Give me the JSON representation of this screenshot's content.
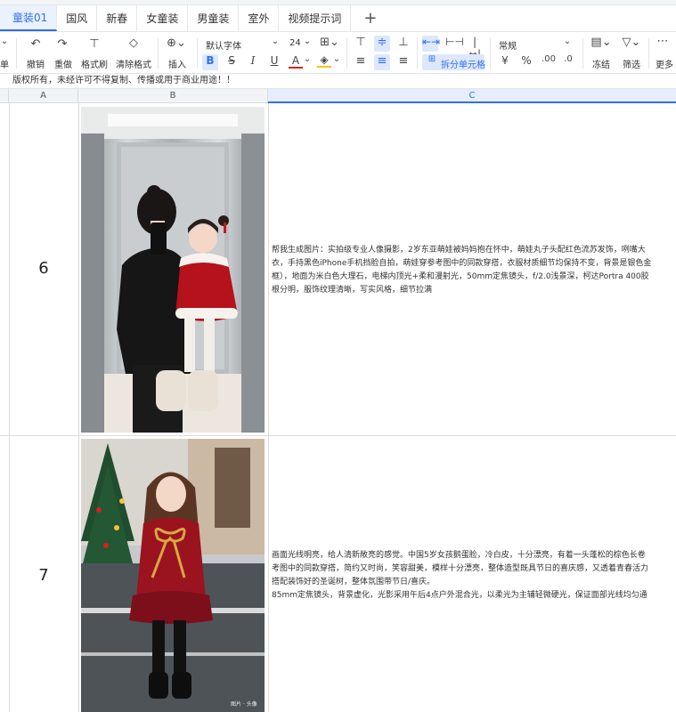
{
  "tabs": [
    {
      "label": "童装01",
      "active": true
    },
    {
      "label": "国风",
      "active": false
    },
    {
      "label": "新春",
      "active": false
    },
    {
      "label": "女童装",
      "active": false
    },
    {
      "label": "男童装",
      "active": false
    },
    {
      "label": "室外",
      "active": false
    },
    {
      "label": "视频提示词",
      "active": false
    }
  ],
  "add_tab_label": "+",
  "toolbar": {
    "left_cut_label": "单",
    "undo": "撤销",
    "redo": "重做",
    "format_painter": "格式刷",
    "clear_format": "清除格式",
    "insert": "插入",
    "font_family": "默认字体",
    "font_size": "24",
    "number_format": "常规",
    "merge": "拆分单元格",
    "currency": "¥",
    "percent": "%",
    "decimal_inc": ".00",
    "decimal_dec": ".0",
    "freeze": "冻结",
    "filter": "筛选",
    "more": "更多",
    "bold": "B",
    "strike": "S",
    "italic": "I",
    "underline": "U",
    "font_color": "A",
    "fill_color": "A"
  },
  "banner": "版权所有，未经许可不得复制、传播或用于商业用途！！",
  "columns": {
    "a": "A",
    "b": "B",
    "c": "C"
  },
  "rows": [
    {
      "num": "6",
      "text": "帮我生成图片：实拍级专业人像摄影，2岁东亚萌娃被妈妈抱在怀中，萌娃丸子头配红色流苏发饰，咧嘴大\n衣，手持黑色iPhone手机挡脸自拍，萌娃穿参考图中的同款穿搭，衣服材质细节均保持不变，背景是银色金\n框），地面为米白色大理石，电梯内顶光+柔和漫射光，50mm定焦镜头，f/2.0浅景深，柯达Portra 400胶\n根分明，服饰纹理清晰，写实风格，细节拉满"
    },
    {
      "num": "7",
      "text": "画面光线明亮，给人清新敞亮的感觉。中国5岁女孩鹅蛋脸，冷白皮，十分漂亮，有着一头蓬松的棕色长卷\n考图中的同款穿搭，简约又时尚，笑容甜美，模样十分漂亮，整体造型既具节日的喜庆感，又透着青春活力\n搭配装饰好的圣诞树，整体氛围带节日/喜庆。\n85mm定焦镜头，背景虚化，光影采用午后4点户外混合光，以柔光为主辅轻微硬光，保证面部光线均匀通"
    }
  ],
  "watermark": "图片 · 头像"
}
